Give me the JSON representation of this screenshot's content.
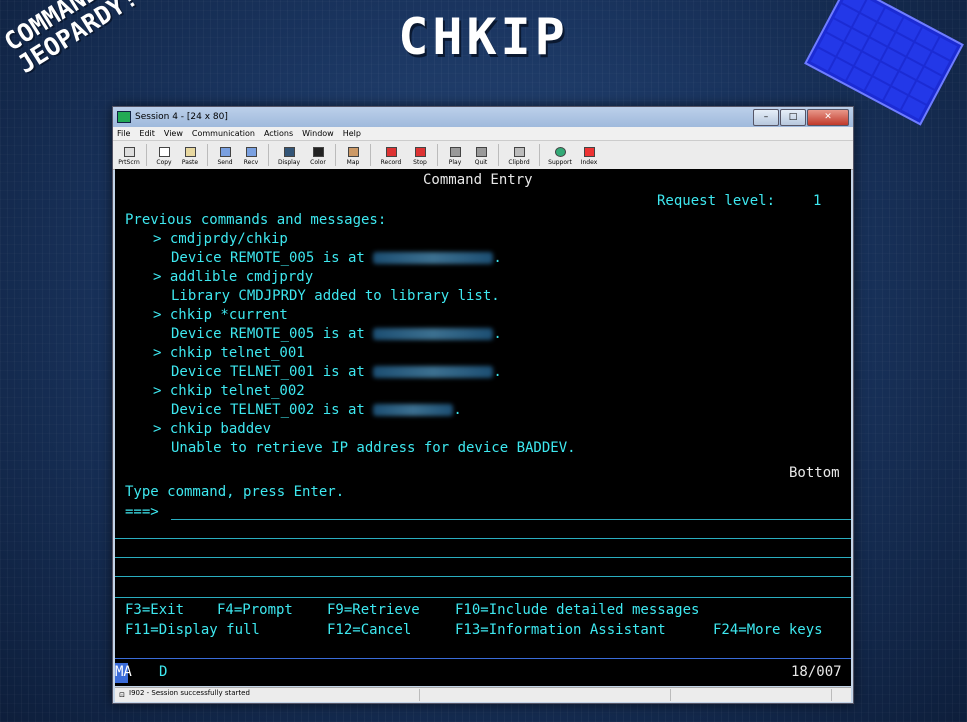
{
  "slide": {
    "title": "CHKIP",
    "logo_line1": "COMMAND",
    "logo_line2": "JEOPARDY!"
  },
  "window": {
    "title": "Session 4 - [24 x 80]",
    "menu": [
      "File",
      "Edit",
      "View",
      "Communication",
      "Actions",
      "Window",
      "Help"
    ],
    "toolbar": [
      "PrtScrn",
      "Copy",
      "Paste",
      "Send",
      "Recv",
      "Display",
      "Color",
      "Map",
      "Record",
      "Stop",
      "Play",
      "Quit",
      "Clipbrd",
      "Support",
      "Index"
    ],
    "status_text": "I902 - Session successfully started"
  },
  "terminal": {
    "header": "Command Entry",
    "request_level_label": "Request level:",
    "request_level_value": "1",
    "previous_label": "Previous commands and messages:",
    "lines": [
      "> cmdjprdy/chkip",
      "Device REMOTE_005 is at",
      "> addlible cmdjprdy",
      "Library CMDJPRDY added to library list.",
      "> chkip *current",
      "Device REMOTE_005 is at",
      "> chkip telnet_001",
      "Device TELNET_001 is at",
      "> chkip telnet_002",
      "Device TELNET_002 is at",
      "> chkip baddev",
      "Unable to retrieve IP address for device BADDEV."
    ],
    "bottom": "Bottom",
    "prompt_text": "Type command, press Enter.",
    "arrow": "===>",
    "fkeys_row1": [
      "F3=Exit",
      "F4=Prompt",
      "F9=Retrieve",
      "F10=Include detailed messages"
    ],
    "fkeys_row2": [
      "F11=Display full",
      "F12=Cancel",
      "F13=Information Assistant",
      "F24=More keys"
    ],
    "status_left": "MA",
    "status_mode": "D",
    "cursor_pos": "18/007"
  }
}
